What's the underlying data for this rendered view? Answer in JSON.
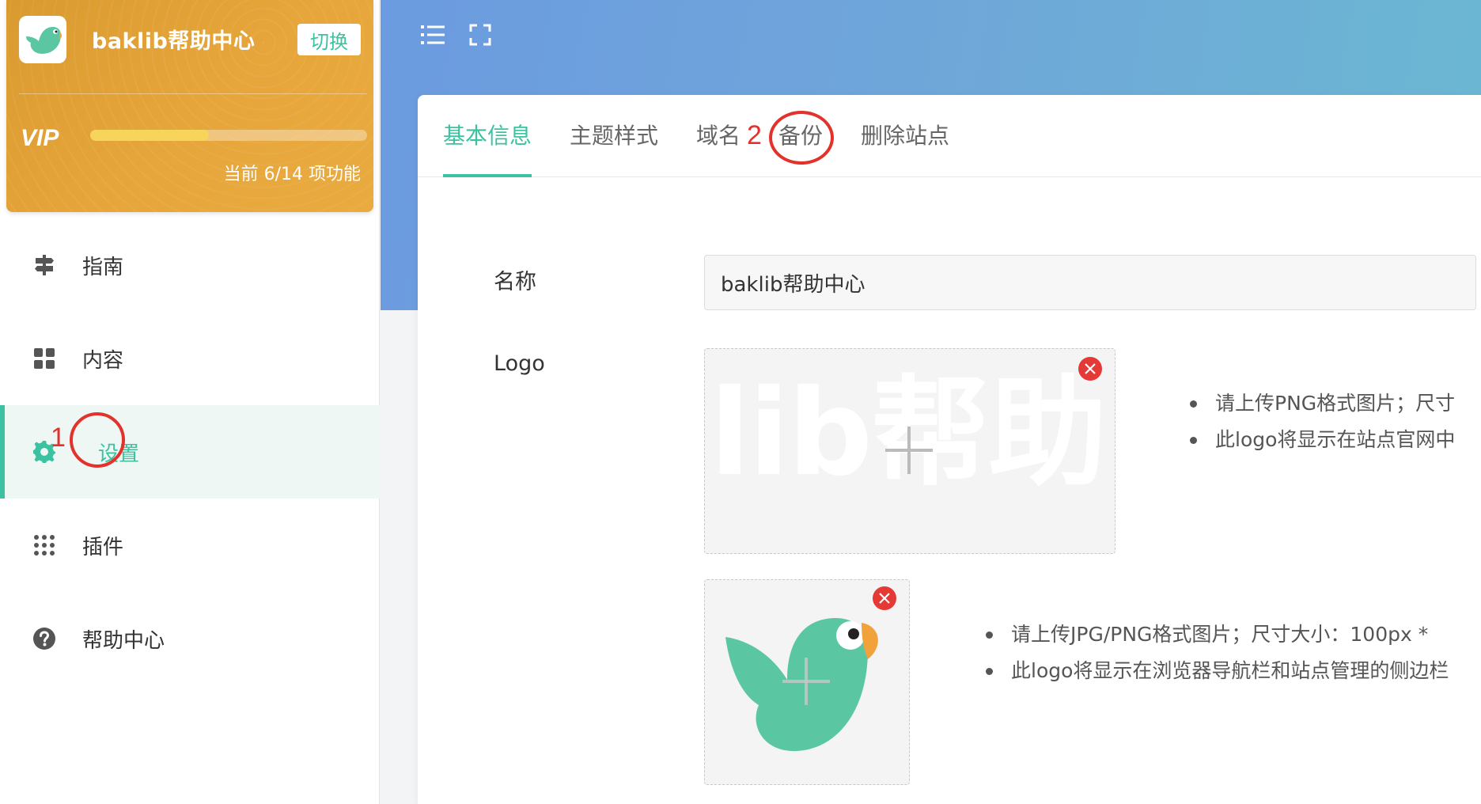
{
  "site": {
    "name": "baklib帮助中心",
    "switch_label": "切换",
    "vip_label": "VIP",
    "vip_status": "当前 6/14 项功能",
    "vip_progress_fraction": 0.4286
  },
  "nav": {
    "items": [
      {
        "label": "指南",
        "icon": "signpost-icon"
      },
      {
        "label": "内容",
        "icon": "grid-icon"
      },
      {
        "label": "设置",
        "icon": "gear-icon",
        "active": true
      },
      {
        "label": "插件",
        "icon": "dots-grid-icon"
      },
      {
        "label": "帮助中心",
        "icon": "question-circle-icon"
      }
    ]
  },
  "toolbar": {
    "menu_icon": "list-menu-icon",
    "fullscreen_icon": "fullscreen-icon"
  },
  "tabs": [
    {
      "label": "基本信息",
      "active": true
    },
    {
      "label": "主题样式"
    },
    {
      "label": "域名"
    },
    {
      "label": "备份"
    },
    {
      "label": "删除站点"
    }
  ],
  "annotations": {
    "step1": "1",
    "step2": "2"
  },
  "form": {
    "name_label": "名称",
    "name_value": "baklib帮助中心",
    "logo_label": "Logo",
    "logo_watermark": "lib帮助",
    "logo_hints": [
      "请上传PNG格式图片；尺寸",
      "此logo将显示在站点官网中"
    ],
    "favicon_hints": [
      "请上传JPG/PNG格式图片；尺寸大小：100px *",
      "此logo将显示在浏览器导航栏和站点管理的侧边栏"
    ]
  },
  "colors": {
    "accent": "#3cc2a0",
    "card_orange": "#e6a53a",
    "topbar_blue": "#6fa7d9",
    "annotation_red": "#e2322b"
  }
}
